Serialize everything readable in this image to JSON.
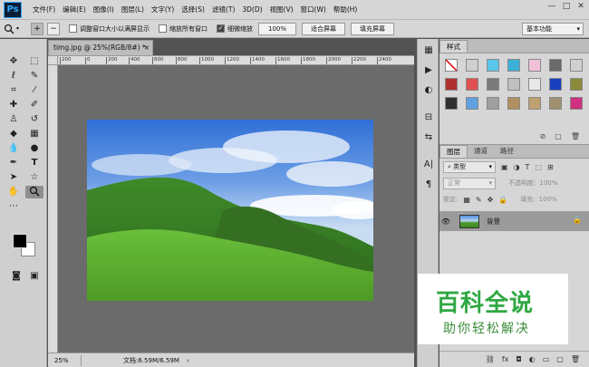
{
  "app": {
    "logo": "Ps"
  },
  "menu": [
    "文件(F)",
    "编辑(E)",
    "图像(I)",
    "图层(L)",
    "文字(Y)",
    "选择(S)",
    "滤镜(T)",
    "3D(D)",
    "视图(V)",
    "窗口(W)",
    "帮助(H)"
  ],
  "window_controls": {
    "minimize": "—",
    "restore": "□",
    "close": "✕"
  },
  "options": {
    "tool_preset_icon": "zoom-icon",
    "zoom_in": "+",
    "zoom_out": "−",
    "resize_windows_label": "调整窗口大小以满屏显示",
    "resize_windows_checked": false,
    "zoom_all_label": "缩放所有窗口",
    "zoom_all_checked": false,
    "scrubby_label": "细微缩放",
    "scrubby_checked": true,
    "zoom_percent_button": "100%",
    "fit_screen_button": "适合屏幕",
    "fill_screen_button": "填充屏幕",
    "workspace": "基本功能"
  },
  "document": {
    "tab_title": "timg.jpg @ 25%(RGB/8#) *",
    "close": "×",
    "ruler_ticks": [
      "200",
      "0",
      "200",
      "400",
      "600",
      "800",
      "1000",
      "1200",
      "1400",
      "1600",
      "1800",
      "2000",
      "2200",
      "2400"
    ]
  },
  "status": {
    "zoom": "25%",
    "doc_info": "文档:6.59M/6.59M",
    "arrow": "›"
  },
  "styles_panel": {
    "tab": "样式",
    "swatches": [
      "#ffffff",
      "#cfcfcf",
      "#5bc6ea",
      "#3ab0d8",
      "#f0c0d8",
      "#6a6a6a",
      "#d0d0d0",
      "#b03030",
      "#e05050",
      "#7a7a7a",
      "#c0c0c0",
      "#e8e8e8",
      "#1a40c0",
      "#8a8a3a",
      "#303030",
      "#60a0e0",
      "#a0a0a0",
      "#b09060",
      "#c0a070",
      "#a09070",
      "#d03080"
    ]
  },
  "layers_panel": {
    "tabs": [
      "图层",
      "通道",
      "路径"
    ],
    "filter_label": "类型",
    "blend_mode": "正常",
    "opacity_label": "不透明度:",
    "opacity_value": "100%",
    "lock_label": "锁定:",
    "fill_label": "填充:",
    "fill_value": "100%",
    "layers": [
      {
        "name": "背景",
        "visible": true,
        "locked": true
      }
    ]
  },
  "watermark": {
    "title": "百科全说",
    "subtitle": "助你轻松解决"
  }
}
